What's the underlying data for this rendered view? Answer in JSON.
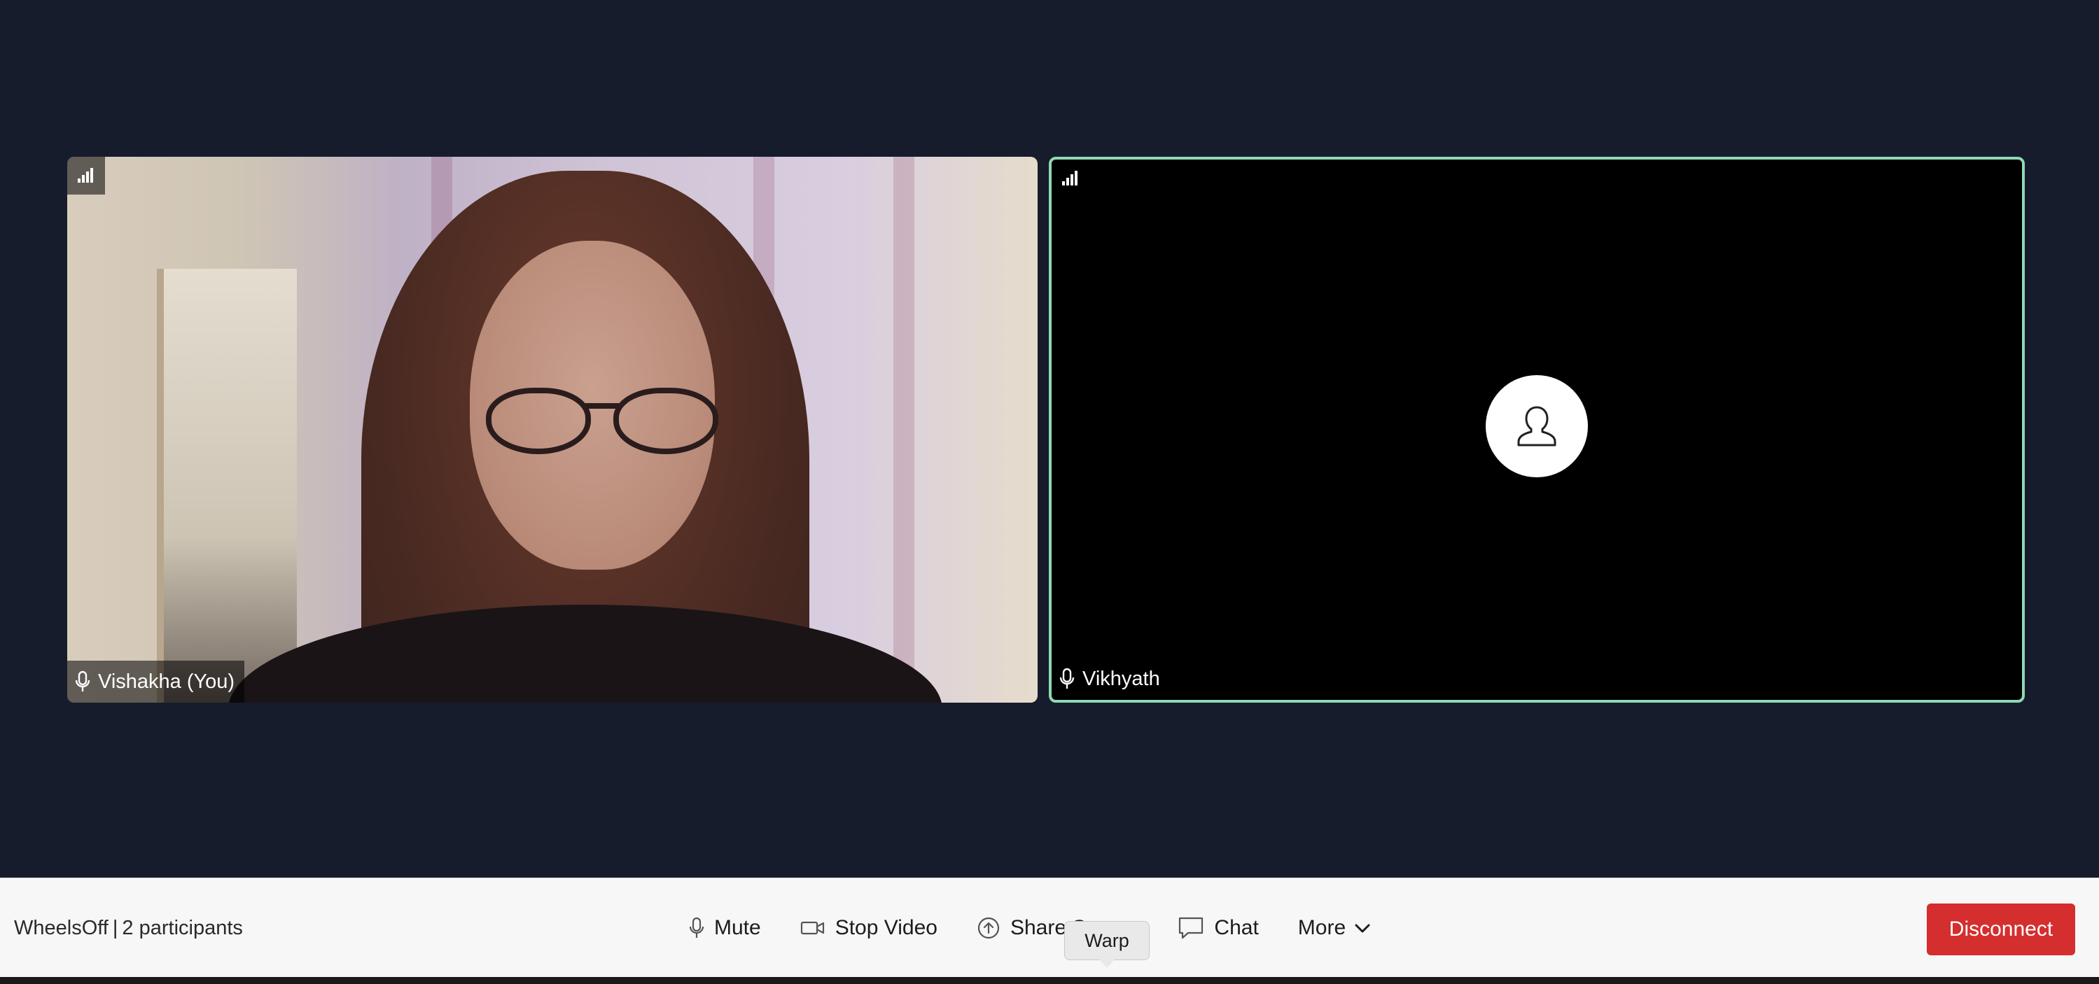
{
  "meeting": {
    "name": "WheelsOff",
    "separator": "|",
    "participants": "2 participants"
  },
  "tiles": [
    {
      "name": "Vishakha (You)",
      "mic_icon": "mic-icon",
      "signal_icon": "signal-bars-icon"
    },
    {
      "name": "Vikhyath",
      "mic_icon": "mic-icon",
      "signal_icon": "signal-bars-icon",
      "avatar_icon": "user-avatar-icon",
      "active_speaker": true
    }
  ],
  "controls": {
    "mute": "Mute",
    "stop_video": "Stop Video",
    "share_screen": "Share Screen",
    "chat": "Chat",
    "more": "More"
  },
  "disconnect": "Disconnect",
  "tooltip": "Warp",
  "colors": {
    "background": "#161c2c",
    "active_border": "#8fd9b4",
    "disconnect": "#d52e2e",
    "toolbar": "#f7f7f7"
  }
}
